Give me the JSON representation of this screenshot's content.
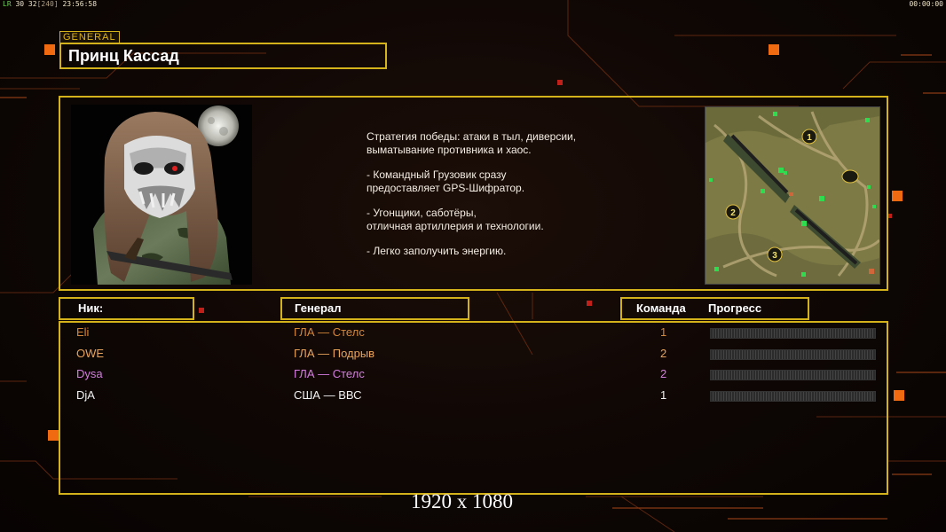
{
  "status": {
    "fps_label": "LR",
    "fps_values": "30 32",
    "fps_bracket": "[240]",
    "clock": "23:56:58",
    "timer": "00:00:00"
  },
  "general_tag": "GENERAL",
  "general_name": "Принц Кассад",
  "description": [
    "Стратегия победы: атаки в тыл, диверсии,\n выматывание противника и хаос.",
    "- Командный Грузовик сразу\nпредоставляет GPS-Шифратор.",
    "- Угонщики, саботёры,\nотличная артиллерия и технологии.",
    "- Легко заполучить энергию."
  ],
  "minimap": {
    "markers": [
      "1",
      "2",
      "3"
    ]
  },
  "headers": {
    "nick": "Ник:",
    "general": "Генерал",
    "team": "Команда",
    "progress": "Прогресс"
  },
  "players": [
    {
      "nick": "Eli",
      "general": "ГЛА — Стелс",
      "team": "1",
      "color": "#d4873a",
      "progress": 0
    },
    {
      "nick": "OWE",
      "general": "ГЛА — Подрыв",
      "team": "2",
      "color": "#e8a45c",
      "progress": 0
    },
    {
      "nick": "Dysa",
      "general": "ГЛА — Стелс",
      "team": "2",
      "color": "#d47ee0",
      "progress": 0
    },
    {
      "nick": "DjA",
      "general": "США — ВВС",
      "team": "1",
      "color": "#f2f2f2",
      "progress": 0
    }
  ],
  "resolution_caption": "1920 x 1080",
  "colors": {
    "frame": "#d4b21c",
    "accent": "#f06a12"
  }
}
